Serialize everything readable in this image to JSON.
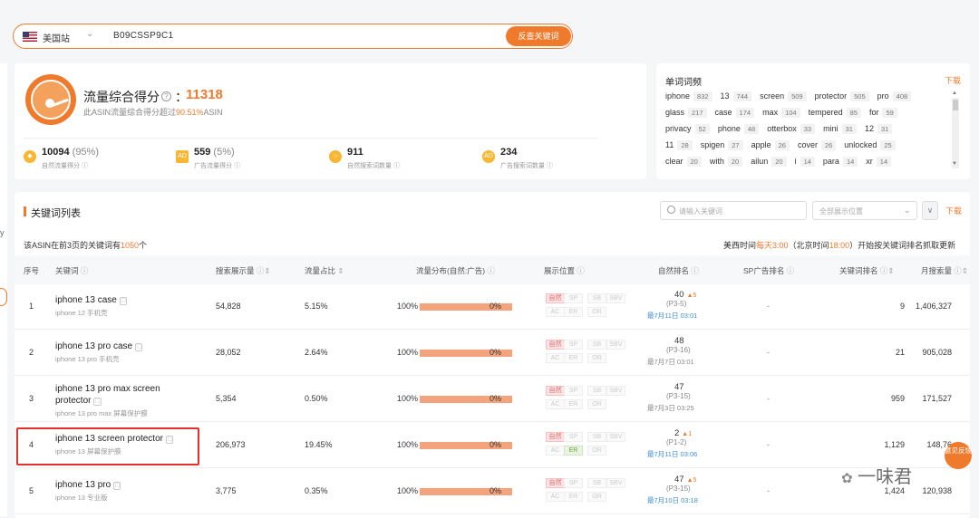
{
  "search": {
    "site": "美国站",
    "asin": "B09CSSP9C1",
    "button": "反查关键词"
  },
  "strip": {
    "letter": "y"
  },
  "score": {
    "title": "流量综合得分",
    "help": "?",
    "colon": "：",
    "value": "11318",
    "sub_prefix": "此ASIN流量综合得分超过",
    "sub_pct": "90.51%",
    "sub_suffix": "ASIN"
  },
  "metrics": [
    {
      "icon": "drop-icon",
      "value": "10094",
      "pct": "(95%)",
      "label": "自然流量得分"
    },
    {
      "icon": "ad-icon",
      "badge": "AD",
      "value": "559",
      "pct": "(5%)",
      "label": "广告流量得分"
    },
    {
      "icon": "search-icon",
      "value": "911",
      "pct": "",
      "label": "自然搜索词数量"
    },
    {
      "icon": "ad-search-icon",
      "badge": "AD",
      "value": "234",
      "pct": "",
      "label": "广告搜索词数量"
    }
  ],
  "word_freq": {
    "title": "单词词频",
    "download": "下载",
    "rows": [
      [
        [
          "iphone",
          "832"
        ],
        [
          "13",
          "744"
        ],
        [
          "screen",
          "509"
        ],
        [
          "protector",
          "505"
        ],
        [
          "pro",
          "408"
        ]
      ],
      [
        [
          "glass",
          "217"
        ],
        [
          "case",
          "174"
        ],
        [
          "max",
          "104"
        ],
        [
          "tempered",
          "85"
        ],
        [
          "for",
          "59"
        ]
      ],
      [
        [
          "privacy",
          "52"
        ],
        [
          "phone",
          "48"
        ],
        [
          "otterbox",
          "33"
        ],
        [
          "mini",
          "31"
        ],
        [
          "12",
          "31"
        ]
      ],
      [
        [
          "11",
          "28"
        ],
        [
          "spigen",
          "27"
        ],
        [
          "apple",
          "26"
        ],
        [
          "cover",
          "26"
        ],
        [
          "unlocked",
          "25"
        ]
      ],
      [
        [
          "clear",
          "20"
        ],
        [
          "with",
          "20"
        ],
        [
          "ailun",
          "20"
        ],
        [
          "i",
          "14"
        ],
        [
          "para",
          "14"
        ],
        [
          "xr",
          "14"
        ]
      ]
    ]
  },
  "keywords": {
    "title": "关键词列表",
    "search_placeholder": "请输入关键词",
    "position_placeholder": "全部展示位置",
    "download": "下载",
    "more": "∨",
    "count_prefix": "该ASIN在前3页的关键词有",
    "count": "1050",
    "count_suffix": "个",
    "time_a": "美西时间",
    "time_b": "每天3:00",
    "time_c": "（北京时间",
    "time_d": "18:00",
    "time_e": "）开始按关键词排名抓取更新",
    "headers": [
      "序号",
      "关键词",
      "搜索展示量",
      "流量占比",
      "流量分布(自然:广告)",
      "展示位置",
      "自然排名",
      "SP广告排名",
      "关键词排名",
      "月搜索量"
    ],
    "rows": [
      {
        "idx": "1",
        "kw": "iphone 13 case",
        "zh": "iphone 12 手机壳",
        "impr": "54,828",
        "share": "5.15%",
        "nat": "100%",
        "ad": "0%",
        "nat_frac": 1.0,
        "rank": "40",
        "up": "5",
        "page": "(P3-5)",
        "date": "最7月11日 03:01",
        "date_blue": true,
        "sp": "-",
        "kwrank": "9",
        "monthly": "1,406,327",
        "er": false
      },
      {
        "idx": "2",
        "kw": "iphone 13 pro case",
        "zh": "iphone 13 pro 手机壳",
        "impr": "28,052",
        "share": "2.64%",
        "nat": "100%",
        "ad": "0%",
        "nat_frac": 1.0,
        "rank": "48",
        "up": "",
        "page": "(P3-16)",
        "date": "最7月7日 03:01",
        "date_blue": false,
        "sp": "-",
        "kwrank": "21",
        "monthly": "905,028",
        "er": false
      },
      {
        "idx": "3",
        "kw": "iphone 13 pro max screen protector",
        "zh": "iphone 13 pro max 屏幕保护膜",
        "impr": "5,354",
        "share": "0.50%",
        "nat": "100%",
        "ad": "0%",
        "nat_frac": 1.0,
        "rank": "47",
        "up": "",
        "page": "(P3-15)",
        "date": "最7月3日 03:25",
        "date_blue": false,
        "sp": "-",
        "kwrank": "959",
        "monthly": "171,527",
        "er": false
      },
      {
        "idx": "4",
        "kw": "iphone 13 screen protector",
        "zh": "iphone 13 屏幕保护膜",
        "impr": "206,973",
        "share": "19.45%",
        "nat": "100%",
        "ad": "0%",
        "nat_frac": 1.0,
        "rank": "2",
        "up": "1",
        "page": "(P1-2)",
        "date": "最7月11日 03:06",
        "date_blue": true,
        "sp": "-",
        "kwrank": "1,129",
        "monthly": "148,76",
        "er": true
      },
      {
        "idx": "5",
        "kw": "iphone 13 pro",
        "zh": "iphone 13 专业版",
        "impr": "3,775",
        "share": "0.35%",
        "nat": "100%",
        "ad": "0%",
        "nat_frac": 1.0,
        "rank": "47",
        "up": "5",
        "page": "(P3-15)",
        "date": "最7月10日 03:18",
        "date_blue": true,
        "sp": "-",
        "kwrank": "1,424",
        "monthly": "120,938",
        "er": false
      }
    ],
    "pos_tags_row1": [
      "自然",
      "SP",
      "SB",
      "SBV"
    ],
    "pos_tags_row2": [
      "AC",
      "ER",
      "OR"
    ]
  },
  "feedback": "意见反馈",
  "watermark": "一味君"
}
